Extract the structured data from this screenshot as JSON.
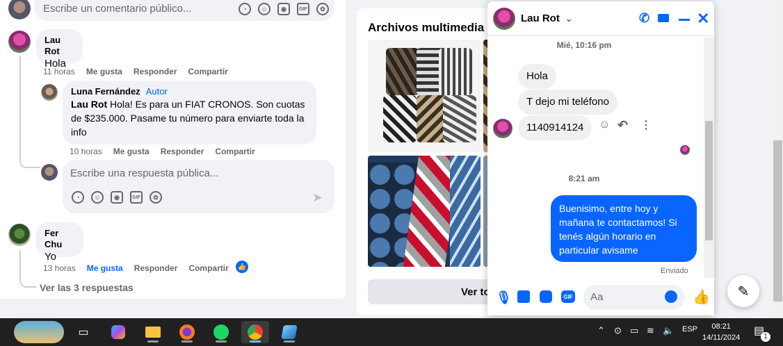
{
  "comments": {
    "top_input_placeholder": "Escribe un comentario público...",
    "c1": {
      "author": "Lau Rot",
      "text": "Hola",
      "time": "11 horas",
      "like": "Me gusta",
      "reply": "Responder",
      "share": "Compartir"
    },
    "r1": {
      "author": "Luna Fernández",
      "badge": "Autor",
      "mention": "Lau Rot",
      "text": " Hola! Es para un FIAT CRONOS. Son cuotas de $235.000. Pasame tu número para enviarte toda la info",
      "time": "10 horas",
      "like": "Me gusta",
      "reply": "Responder",
      "share": "Compartir"
    },
    "reply_placeholder": "Escribe una respuesta pública...",
    "c2": {
      "author": "Fer Chu",
      "text": "Yo",
      "time": "13 horas",
      "like": "Me gusta",
      "reply": "Responder",
      "share": "Compartir"
    },
    "view_replies": "Ver las 3 respuestas"
  },
  "media": {
    "title": "Archivos multimedia re",
    "see_button": "Ver to"
  },
  "chat": {
    "name": "Lau Rot",
    "ts1": "Mié, 10:16 pm",
    "m1": "Hola",
    "m2": "T dejo mi teléfono",
    "m3": "1140914124",
    "ts2": "8:21 am",
    "reply": "Buenisimo, entre hoy y mañana te contactamos! Si tenés algún horario en particular avisame",
    "status": "Enviado",
    "input_placeholder": "Aa",
    "accent": "#0866ff"
  },
  "taskbar": {
    "lang": "ESP",
    "time": "08:21",
    "date": "14/11/2024",
    "notif_count": "1"
  }
}
